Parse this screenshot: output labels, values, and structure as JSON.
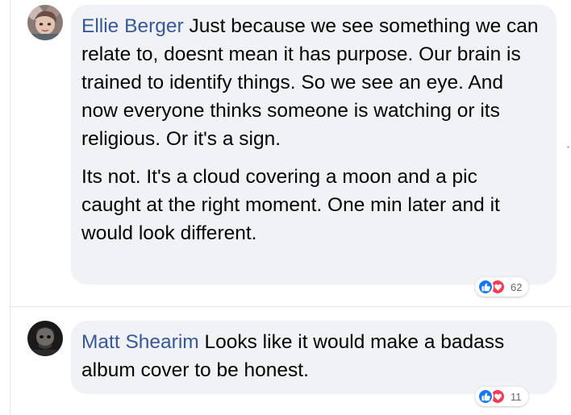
{
  "comments": [
    {
      "author": "Ellie Berger",
      "paragraphs": [
        "Just because we see something we can relate to, doesnt mean it has purpose. Our brain is trained to identify things. So we see an eye. And now everyone thinks someone is watching or its religious. Or it's a sign.",
        "Its not. It's a cloud covering a moon and a pic caught at the right moment. One min later and it would look different."
      ],
      "reactions": {
        "icons": [
          "like-icon",
          "love-icon"
        ],
        "count": "62"
      }
    },
    {
      "author": "Matt Shearim",
      "paragraphs": [
        "Looks like it would make a badass album cover to be honest."
      ],
      "reactions": {
        "icons": [
          "like-icon",
          "love-icon"
        ],
        "count": "11"
      }
    }
  ],
  "colors": {
    "author_link": "#385898",
    "bubble_bg": "#f0f2f5",
    "text": "#050505",
    "like": "#1877f2",
    "love": "#f33e58",
    "count": "#65676b"
  }
}
